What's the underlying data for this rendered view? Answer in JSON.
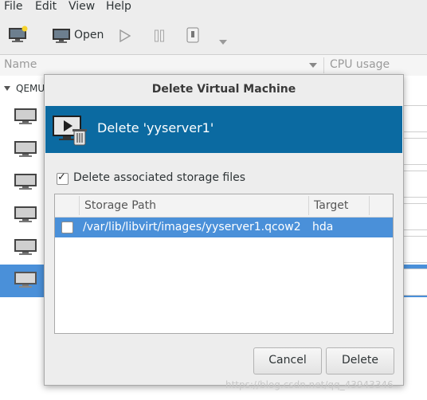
{
  "menubar": {
    "file": "File",
    "edit": "Edit",
    "view": "View",
    "help": "Help"
  },
  "toolbar": {
    "open_label": "Open"
  },
  "columns": {
    "name": "Name",
    "cpu": "CPU usage"
  },
  "tree": {
    "connection": "QEMU"
  },
  "dialog": {
    "title": "Delete Virtual Machine",
    "banner": "Delete 'yyserver1'",
    "delete_storage_label": "Delete associated storage files",
    "delete_storage_checked": true,
    "table": {
      "headers": [
        "Storage Path",
        "Target"
      ],
      "rows": [
        {
          "checked": false,
          "path": "/var/lib/libvirt/images/yyserver1.qcow2",
          "target": "hda"
        }
      ]
    },
    "cancel_label": "Cancel",
    "delete_label": "Delete"
  },
  "watermark": "https://blog.csdn.net/qq_43943346",
  "colors": {
    "banner": "#0b6aa1",
    "selection": "#4a90d9"
  }
}
